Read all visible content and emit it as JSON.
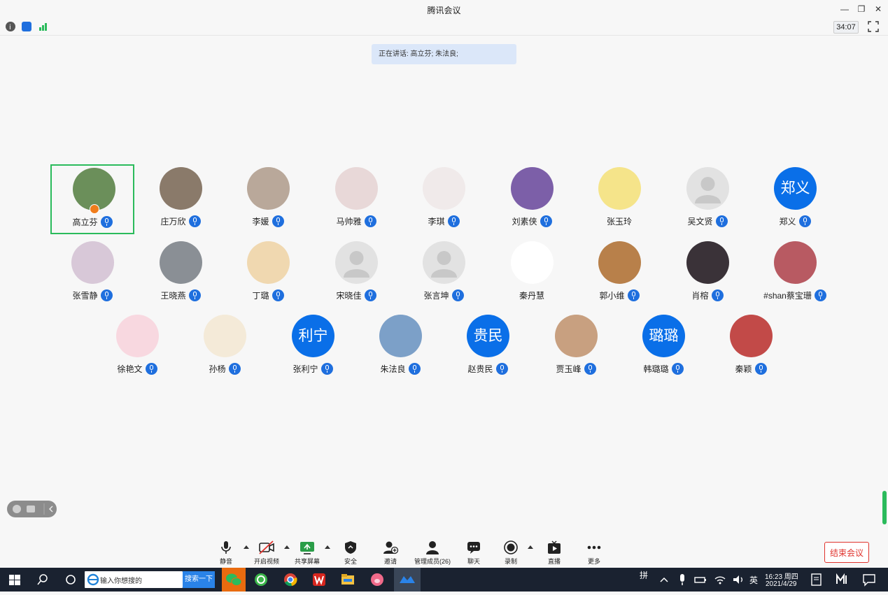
{
  "window": {
    "title": "腾讯会议",
    "timer": "34:07"
  },
  "speaking": "正在讲话: 高立芬; 朱法良;",
  "participants": [
    {
      "name": "高立芬",
      "avatar": "photo",
      "host": true,
      "active": true
    },
    {
      "name": "庄万欣",
      "avatar": "photo"
    },
    {
      "name": "李媛",
      "avatar": "photo"
    },
    {
      "name": "马帅雅",
      "avatar": "photo"
    },
    {
      "name": "李琪",
      "avatar": "photo"
    },
    {
      "name": "刘素侠",
      "avatar": "photo"
    },
    {
      "name": "张玉玲",
      "avatar": "photo",
      "mic": false
    },
    {
      "name": "吴文贤",
      "avatar": "default"
    },
    {
      "name": "郑义",
      "avatar": "text",
      "avatar_text": "郑义"
    },
    {
      "name": "张雪静",
      "avatar": "photo"
    },
    {
      "name": "王晓燕",
      "avatar": "photo"
    },
    {
      "name": "丁璐",
      "avatar": "photo"
    },
    {
      "name": "宋晓佳",
      "avatar": "default"
    },
    {
      "name": "张言坤",
      "avatar": "default"
    },
    {
      "name": "秦丹慧",
      "avatar": "photo",
      "mic": false
    },
    {
      "name": "郭小维",
      "avatar": "photo"
    },
    {
      "name": "肖榕",
      "avatar": "photo"
    },
    {
      "name": "#shan蔡宝珊",
      "avatar": "photo"
    },
    {
      "name": "徐艳文",
      "avatar": "photo"
    },
    {
      "name": "孙杨",
      "avatar": "photo"
    },
    {
      "name": "张利宁",
      "avatar": "text",
      "avatar_text": "利宁"
    },
    {
      "name": "朱法良",
      "avatar": "photo"
    },
    {
      "name": "赵贵民",
      "avatar": "text",
      "avatar_text": "贵民"
    },
    {
      "name": "贾玉峰",
      "avatar": "photo"
    },
    {
      "name": "韩璐璐",
      "avatar": "text",
      "avatar_text": "璐璐"
    },
    {
      "name": "秦颖",
      "avatar": "photo"
    }
  ],
  "toolbar": {
    "mute": "静音",
    "video": "开启视频",
    "share": "共享屏幕",
    "security": "安全",
    "invite": "邀请",
    "members": "管理成员(26)",
    "chat": "聊天",
    "record": "录制",
    "live": "直播",
    "more": "更多",
    "end": "结束会议"
  },
  "taskbar": {
    "search_placeholder": "输入你想搜的",
    "search_button": "搜索一下",
    "ime": "拼",
    "lang": "英",
    "time": "16:23 周四",
    "date": "2021/4/29"
  },
  "colors": {
    "accent": "#0a6fe8",
    "active_border": "#2bbb5c",
    "end": "#e0332d"
  }
}
